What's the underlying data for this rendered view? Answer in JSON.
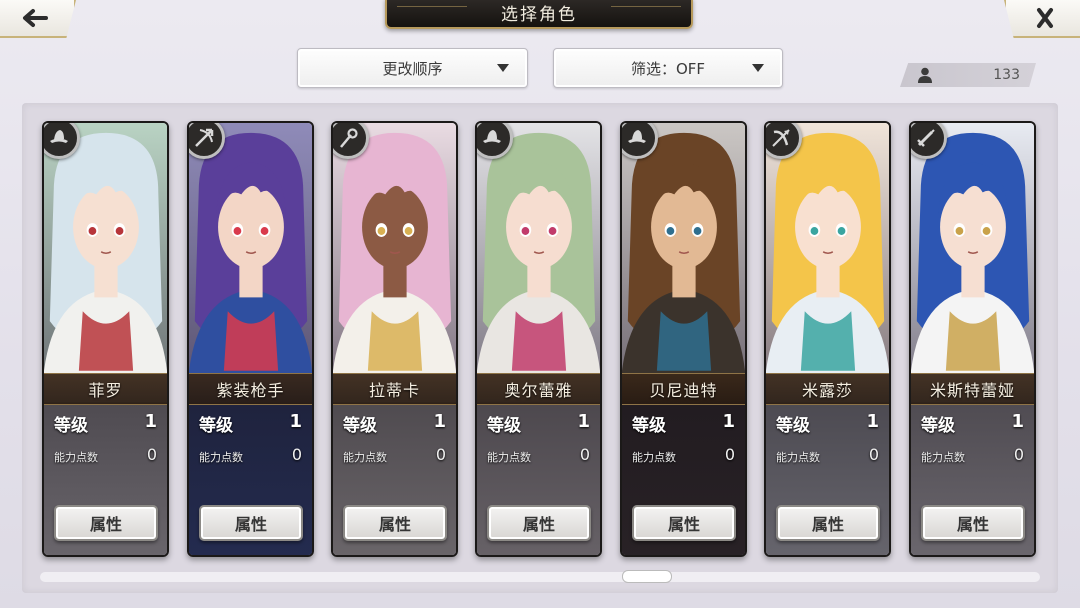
{
  "header": {
    "title": "选择角色",
    "back_icon": "back-arrow-icon",
    "close_icon": "close-icon"
  },
  "controls": {
    "order_label": "更改顺序",
    "filter_label": "筛选：OFF",
    "count_icon": "user-icon",
    "count": "133"
  },
  "card_labels": {
    "level": "等级",
    "points": "能力点数",
    "attr_button": "属性"
  },
  "characters": [
    {
      "name": "菲罗",
      "level": "1",
      "points": "0",
      "weapon": "hat-icon",
      "colors": {
        "hair": "#d6e4ec",
        "skin": "#f6e0d2",
        "cloth": "#f1f1ee",
        "accent": "#b7353a",
        "bg": "#b9d3c3"
      }
    },
    {
      "name": "紫装枪手",
      "level": "1",
      "points": "0",
      "weapon": "crossbow-icon",
      "colors": {
        "hair": "#5a3f9a",
        "skin": "#f3d6c6",
        "cloth": "#2f4fa0",
        "accent": "#d93a4c",
        "bg": "#8f8bb9"
      }
    },
    {
      "name": "拉蒂卡",
      "level": "1",
      "points": "0",
      "weapon": "staff-icon",
      "colors": {
        "hair": "#e7b5d2",
        "skin": "#8c5a44",
        "cloth": "#f3f0ea",
        "accent": "#d8b052",
        "bg": "#e9dbe2"
      }
    },
    {
      "name": "奥尔蕾雅",
      "level": "1",
      "points": "0",
      "weapon": "hat-icon",
      "colors": {
        "hair": "#a9c39a",
        "skin": "#f6ddd0",
        "cloth": "#e9e6e2",
        "accent": "#c13b6b",
        "bg": "#e3e3e6"
      }
    },
    {
      "name": "贝尼迪特",
      "level": "1",
      "points": "0",
      "weapon": "hat-icon",
      "colors": {
        "hair": "#6a4426",
        "skin": "#e2b994",
        "cloth": "#3b332c",
        "accent": "#2f6f8f",
        "bg": "#cbc7c4"
      }
    },
    {
      "name": "米露莎",
      "level": "1",
      "points": "0",
      "weapon": "bow-icon",
      "colors": {
        "hair": "#f4c54a",
        "skin": "#f8e0d0",
        "cloth": "#e8eef3",
        "accent": "#3aa5a0",
        "bg": "#f0e4d9"
      }
    },
    {
      "name": "米斯特蕾娅",
      "level": "1",
      "points": "0",
      "weapon": "sword-icon",
      "colors": {
        "hair": "#2d56b3",
        "skin": "#f6dfd2",
        "cloth": "#f4f4f4",
        "accent": "#c9a24a",
        "bg": "#e8ebf2"
      }
    }
  ]
}
